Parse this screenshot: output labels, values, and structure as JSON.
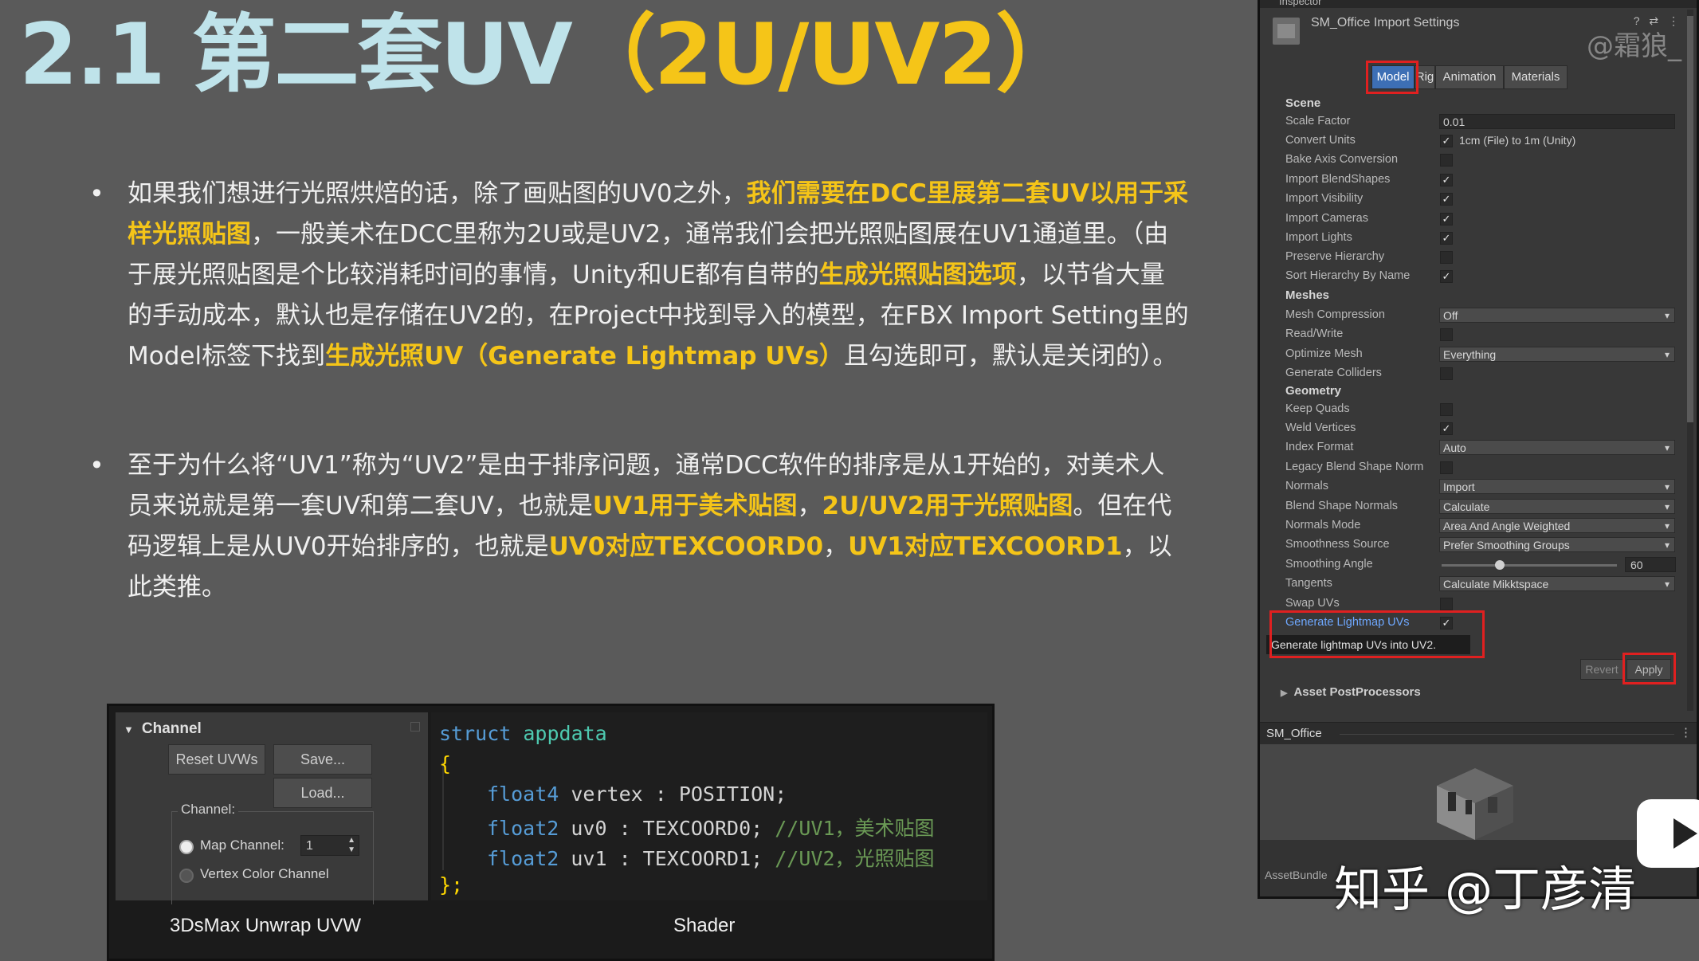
{
  "title": {
    "part1": "2.1 第二套UV",
    "part2": "（2U/UV2）"
  },
  "bullets": [
    {
      "bullet_char": "•",
      "segments": [
        {
          "text": "如果我们想进行光照烘焙的话，除了画贴图的UV0之外，",
          "hl": false
        },
        {
          "text": "我们需要在DCC里展第二套UV以用于采样光照贴图",
          "hl": true
        },
        {
          "text": "，一般美术在DCC里称为2U或是UV2，通常我们会把光照贴图展在UV1通道里。（由于展光照贴图是个比较消耗时间的事情，Unity和UE都有自带的",
          "hl": false
        },
        {
          "text": "生成光照贴图选项",
          "hl": true
        },
        {
          "text": "，以节省大量的手动成本，默认也是存储在UV2的，在Project中找到导入的模型，在FBX Import Setting里的Model标签下找到",
          "hl": false
        },
        {
          "text": "生成光照UV（Generate Lightmap UVs）",
          "hl": true
        },
        {
          "text": "且勾选即可，默认是关闭的）。",
          "hl": false
        }
      ]
    },
    {
      "bullet_char": "•",
      "segments": [
        {
          "text": "至于为什么将“UV1”称为“UV2”是由于排序问题，通常DCC软件的排序是从1开始的，对美术人员来说就是第一套UV和第二套UV，也就是",
          "hl": false
        },
        {
          "text": "UV1用于美术贴图",
          "hl": true
        },
        {
          "text": "，",
          "hl": false
        },
        {
          "text": "2U/UV2用于光照贴图",
          "hl": true
        },
        {
          "text": "。但在代码逻辑上是从UV0开始排序的，也就是",
          "hl": false
        },
        {
          "text": "UV0对应TEXCOORD0",
          "hl": true
        },
        {
          "text": "，",
          "hl": false
        },
        {
          "text": "UV1对应TEXCOORD1",
          "hl": true
        },
        {
          "text": "，以此类推。",
          "hl": false
        }
      ]
    }
  ],
  "max_panel": {
    "header": "Channel",
    "reset_button": "Reset UVWs",
    "save_button": "Save...",
    "load_button": "Load...",
    "channel_group_label": "Channel:",
    "map_channel_label": "Map Channel:",
    "map_channel_value": "1",
    "vertex_color_label": "Vertex Color Channel",
    "caption": "3DsMax Unwrap UVW"
  },
  "code": {
    "line1_kw": "struct",
    "line1_name": "appdata",
    "open_brace": "{",
    "l3_type": "float4",
    "l3_rest": " vertex : POSITION;",
    "l4_type": "float2",
    "l4_rest": " uv0 : TEXCOORD0; ",
    "l4_comment": "//UV1，美术贴图",
    "l5_type": "float2",
    "l5_rest": " uv1 : TEXCOORD1; ",
    "l5_comment": "//UV2，光照贴图",
    "close_brace": "};",
    "caption": "Shader"
  },
  "inspector": {
    "tab_label": "Inspector",
    "title": "SM_Office Import Settings",
    "header_icons": "? ⇄ ⋮",
    "watermark": "@霜狼_",
    "tabs": [
      "Model",
      "Rig",
      "Animation",
      "Materials"
    ],
    "sections": {
      "scene": "Scene",
      "meshes": "Meshes",
      "geometry": "Geometry"
    },
    "rows": {
      "scale_factor": {
        "label": "Scale Factor",
        "value": "0.01"
      },
      "convert_units": {
        "label": "Convert Units",
        "check": "✓",
        "note": "1cm (File) to 1m (Unity)"
      },
      "bake_axis": {
        "label": "Bake Axis Conversion"
      },
      "import_blendshapes": {
        "label": "Import BlendShapes",
        "check": "✓"
      },
      "import_visibility": {
        "label": "Import Visibility",
        "check": "✓"
      },
      "import_cameras": {
        "label": "Import Cameras",
        "check": "✓"
      },
      "import_lights": {
        "label": "Import Lights",
        "check": "✓"
      },
      "preserve_hierarchy": {
        "label": "Preserve Hierarchy"
      },
      "sort_hierarchy": {
        "label": "Sort Hierarchy By Name",
        "check": "✓"
      },
      "mesh_compression": {
        "label": "Mesh Compression",
        "value": "Off"
      },
      "read_write": {
        "label": "Read/Write"
      },
      "optimize_mesh": {
        "label": "Optimize Mesh",
        "value": "Everything"
      },
      "generate_colliders": {
        "label": "Generate Colliders"
      },
      "keep_quads": {
        "label": "Keep Quads"
      },
      "weld_vertices": {
        "label": "Weld Vertices",
        "check": "✓"
      },
      "index_format": {
        "label": "Index Format",
        "value": "Auto"
      },
      "legacy_blend": {
        "label": "Legacy Blend Shape Norm"
      },
      "normals": {
        "label": "Normals",
        "value": "Import"
      },
      "blend_shape_normals": {
        "label": "Blend Shape Normals",
        "value": "Calculate"
      },
      "normals_mode": {
        "label": "Normals Mode",
        "value": "Area And Angle Weighted"
      },
      "smoothness_source": {
        "label": "Smoothness Source",
        "value": "Prefer Smoothing Groups"
      },
      "smoothing_angle": {
        "label": "Smoothing Angle",
        "value": "60"
      },
      "tangents": {
        "label": "Tangents",
        "value": "Calculate Mikktspace"
      },
      "swap_uvs": {
        "label": "Swap UVs"
      },
      "generate_lightmap": {
        "label": "Generate Lightmap UVs",
        "check": "✓"
      }
    },
    "tooltip": "Generate lightmap UVs into UV2.",
    "revert_button": "Revert",
    "apply_button": "Apply",
    "postprocessors": "Asset PostProcessors",
    "preview_name": "SM_Office",
    "preview_dots": "⋮",
    "assetbundle_label": "AssetBundle"
  },
  "zhihu_watermark": "知乎 @丁彦清"
}
